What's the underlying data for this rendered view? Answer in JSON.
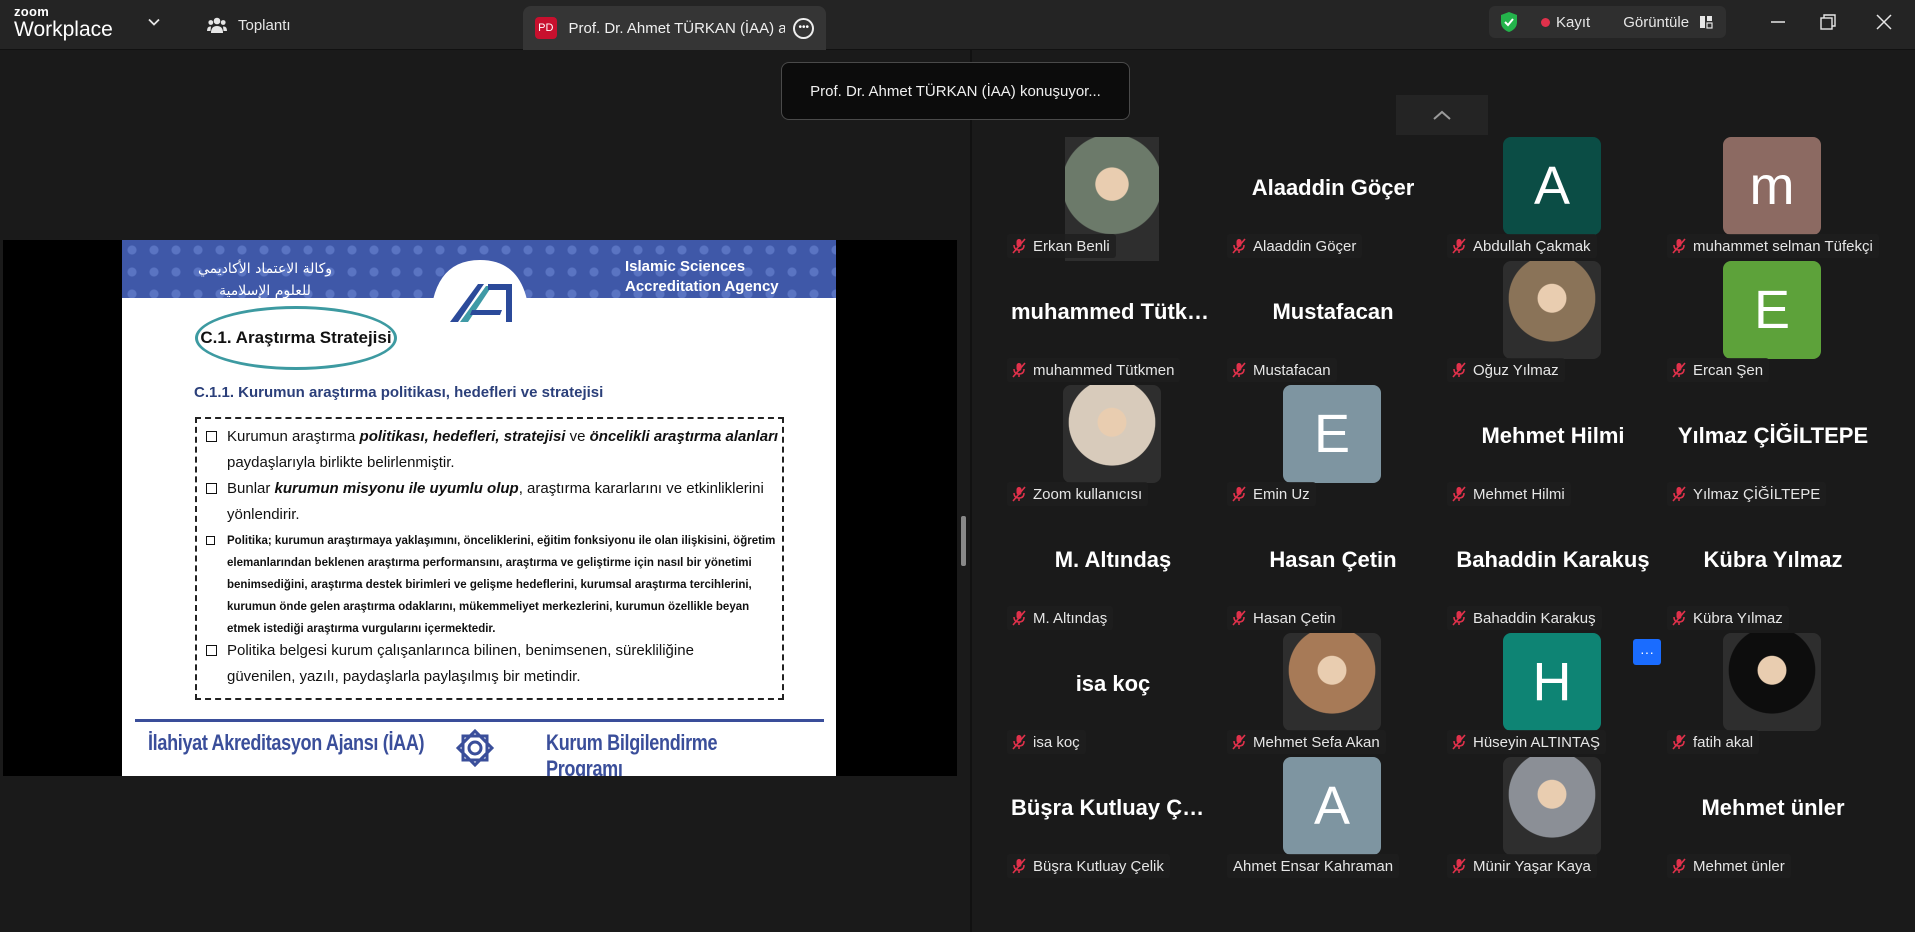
{
  "app": {
    "brand_top": "zoom",
    "brand_bottom": "Workplace"
  },
  "meeting": {
    "label": "Toplantı"
  },
  "active_tab": {
    "avatar": "PD",
    "title": "Prof. Dr. Ahmet TÜRKAN (İAA) adlı kişinin ekranı"
  },
  "status": {
    "record_label": "Kayıt",
    "view_label": "Görüntüle"
  },
  "toast": "Prof. Dr. Ahmet TÜRKAN (İAA) konuşuyor...",
  "slide": {
    "arabic_line1": "وكالة الاعتماد الأكاديمي",
    "arabic_line2": "للعلوم الإسلامية",
    "english_line1": "Islamic Sciences",
    "english_line2": "Accreditation Agency",
    "oval_title": "C.1. Araştırma Stratejisi",
    "subtitle": "C.1.1. Kurumun araştırma politikası, hedefleri ve stratejisi",
    "b1_a": "Kurumun araştırma ",
    "b1_b": "politikası, hedefleri, stratejisi",
    "b1_c": " ve ",
    "b1_d": "öncelikli araştırma alanları",
    "b1_e": " paydaşlarıyla birlikte belirlenmiştir.",
    "b2_a": "Bunlar ",
    "b2_b": "kurumun misyonu ile uyumlu olup",
    "b2_c": ", araştırma kararlarını ve etkinliklerini yönlendirir.",
    "b3": "Politika; kurumun araştırmaya yaklaşımını, önceliklerini, eğitim fonksiyonu ile olan ilişkisini, öğretim elemanlarından beklenen araştırma performansını, araştırma ve geliştirme için nasıl bir yönetimi benimsediğini, araştırma destek birimleri ve gelişme hedeflerini, kurumsal araştırma tercihlerini, kurumun önde gelen araştırma odaklarını, mükemmeliyet merkezlerini, kurumun özellikle beyan etmek istediği araştırma vurgularını içermektedir.",
    "b4": "Politika belgesi kurum çalışanlarınca bilinen, benimsenen, sürekliliğine güvenilen, yazılı, paydaşlarla paylaşılmış bir metindir.",
    "footer_left": "İlahiyat Akreditasyon Ajansı (İAA)",
    "footer_right": "Kurum Bilgilendirme Programı"
  },
  "more_label": "···",
  "participants": [
    {
      "name": "Erkan Benli",
      "type": "photo",
      "color": "#6c7a6a",
      "muted": true
    },
    {
      "name": "Alaaddin Göçer",
      "big": "Alaaddin Göçer",
      "type": "name",
      "muted": true
    },
    {
      "name": "Abdullah Çakmak",
      "type": "letter",
      "letter": "A",
      "color": "#0b4d45",
      "muted": true
    },
    {
      "name": "muhammet selman Tüfekçi",
      "type": "letter",
      "letter": "m",
      "color": "#8c6a62",
      "muted": true
    },
    {
      "name": "muhammed Tütkmen",
      "big": "muhammed Tütkmen",
      "type": "name",
      "muted": true
    },
    {
      "name": "Mustafacan",
      "big": "Mustafacan",
      "type": "name",
      "muted": true
    },
    {
      "name": "Oğuz Yılmaz",
      "type": "photo",
      "color": "#8a7358",
      "muted": true
    },
    {
      "name": "Ercan Şen",
      "type": "letter",
      "letter": "E",
      "color": "#5da23a",
      "muted": true
    },
    {
      "name": "Zoom kullanıcısı",
      "type": "photo",
      "color": "#d8cbbb",
      "muted": true
    },
    {
      "name": "Emin Uz",
      "type": "letter",
      "letter": "E",
      "color": "#7e95a1",
      "muted": true
    },
    {
      "name": "Mehmet Hilmi",
      "big": "Mehmet Hilmi",
      "type": "name",
      "muted": true
    },
    {
      "name": "Yılmaz ÇİĞİLTEPE",
      "big": "Yılmaz ÇİĞİLTEPE",
      "type": "name",
      "muted": true
    },
    {
      "name": "M. Altındaş",
      "big": "M. Altındaş",
      "type": "name",
      "muted": true
    },
    {
      "name": "Hasan Çetin",
      "big": "Hasan Çetin",
      "type": "name",
      "muted": true
    },
    {
      "name": "Bahaddin Karakuş",
      "big": "Bahaddin Karakuş",
      "type": "name",
      "muted": true
    },
    {
      "name": "Kübra Yılmaz",
      "big": "Kübra Yılmaz",
      "type": "name",
      "muted": true
    },
    {
      "name": "isa koç",
      "big": "isa koç",
      "type": "name",
      "muted": true
    },
    {
      "name": "Mehmet Sefa Akan",
      "type": "photo",
      "color": "#a77a57",
      "muted": true
    },
    {
      "name": "Hüseyin ALTINTAŞ",
      "type": "letter",
      "letter": "H",
      "color": "#0e8474",
      "muted": true
    },
    {
      "name": "fatih akal",
      "type": "photo",
      "color": "#0d0d0d",
      "muted": true
    },
    {
      "name": "Büşra Kutluay Çelik",
      "big": "Büşra Kutluay Çelik",
      "type": "name",
      "muted": true
    },
    {
      "name": "Ahmet Ensar Kahraman",
      "type": "letter",
      "letter": "A",
      "color": "#7e95a1",
      "muted": false
    },
    {
      "name": "Münir Yaşar Kaya",
      "type": "photo",
      "color": "#8b8f96",
      "muted": true
    },
    {
      "name": "Mehmet ünler",
      "big": "Mehmet ünler",
      "type": "name",
      "muted": true
    }
  ],
  "colors": {
    "accent": "#1a6cff",
    "record": "#e0314b",
    "shield": "#24b34b",
    "muted_mic": "#e0314b"
  }
}
